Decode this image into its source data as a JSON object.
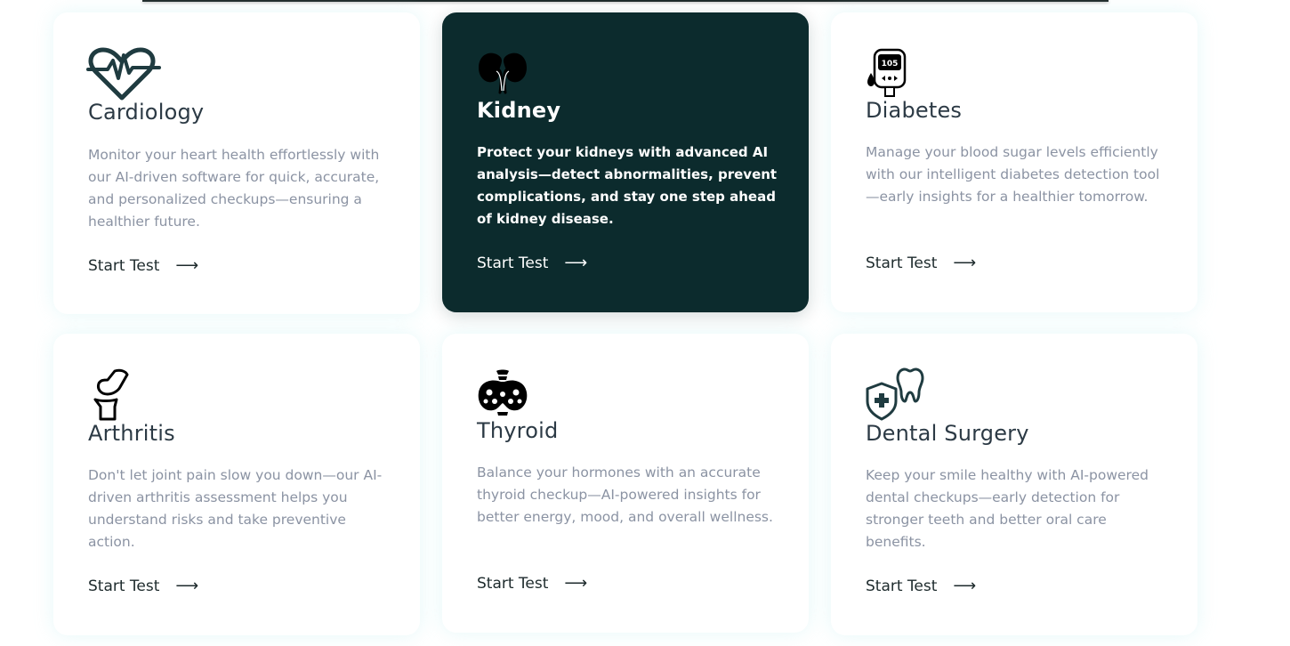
{
  "cards": [
    {
      "title": "Cardiology",
      "description": "Monitor your heart health effortlessly with our AI-driven software for quick, accurate, and personalized checkups—ensuring a healthier future.",
      "cta": "Start Test",
      "icon": "heart-rate-icon",
      "active": false
    },
    {
      "title": "Kidney",
      "description": "Protect your kidneys with advanced AI analysis—detect abnormalities, prevent complications, and stay one step ahead of kidney disease.",
      "cta": "Start Test",
      "icon": "kidney-icon",
      "active": true
    },
    {
      "title": "Diabetes",
      "description": "Manage your blood sugar levels efficiently with our intelligent diabetes detection tool—early insights for a healthier tomorrow.",
      "cta": "Start Test",
      "icon": "glucometer-icon",
      "glucometer_reading": "105",
      "active": false
    },
    {
      "title": "Arthritis",
      "description": "Don't let joint pain slow you down—our AI-driven arthritis assessment helps you understand risks and take preventive action.",
      "cta": "Start Test",
      "icon": "knee-joint-icon",
      "active": false
    },
    {
      "title": "Thyroid",
      "description": "Balance your hormones with an accurate thyroid checkup—AI-powered insights for better energy, mood, and overall wellness.",
      "cta": "Start Test",
      "icon": "thyroid-icon",
      "active": false
    },
    {
      "title": "Dental Surgery",
      "description": "Keep your smile healthy with AI-powered dental checkups—early detection for stronger teeth and better oral care benefits.",
      "cta": "Start Test",
      "icon": "dental-shield-icon",
      "active": false
    }
  ],
  "arrow_glyph": "⟶",
  "colors": {
    "active_card_bg": "#0c2b2d",
    "title_text": "#2c3a45",
    "description_text": "#8b93a3",
    "link_text": "#1d2a2c",
    "card_glow": "#a5e6eb"
  }
}
